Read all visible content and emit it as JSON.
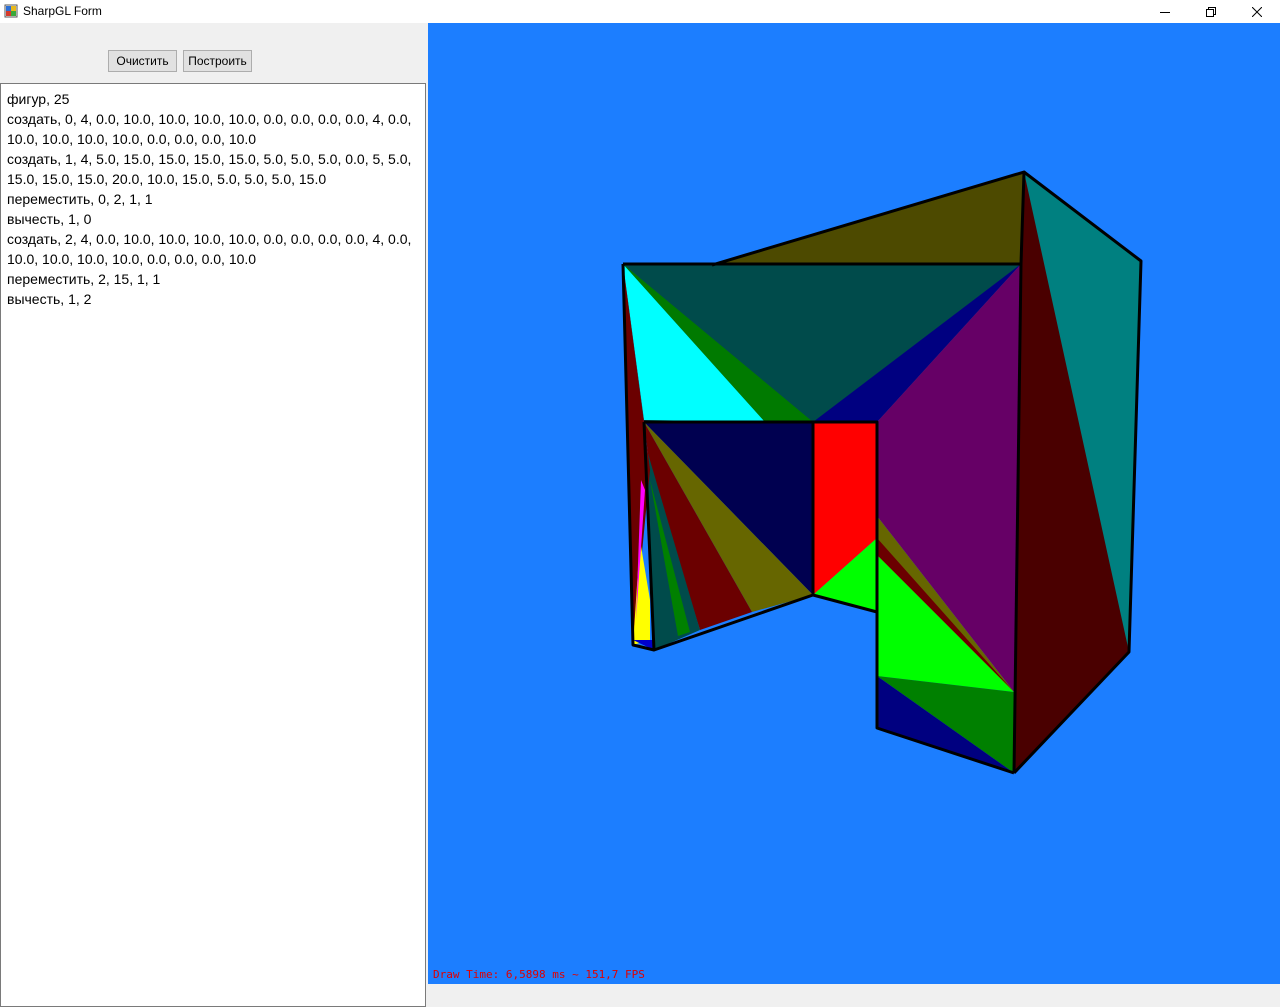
{
  "window": {
    "title": "SharpGL Form"
  },
  "toolbar": {
    "clear_label": "Очистить",
    "build_label": "Построить"
  },
  "script_text": "фигур, 25\nсоздать, 0, 4, 0.0, 10.0, 10.0, 10.0, 10.0, 0.0, 0.0, 0.0, 0.0, 4, 0.0, 10.0, 10.0, 10.0, 10.0, 0.0, 0.0, 0.0, 10.0\nсоздать, 1, 4, 5.0, 15.0, 15.0, 15.0, 15.0, 5.0, 5.0, 5.0, 0.0, 5, 5.0, 15.0, 15.0, 15.0, 20.0, 10.0, 15.0, 5.0, 5.0, 5.0, 15.0\nпереместить, 0, 2, 1, 1\nвычесть, 1, 0\nсоздать, 2, 4, 0.0, 10.0, 10.0, 10.0, 10.0, 0.0, 0.0, 0.0, 0.0, 4, 0.0, 10.0, 10.0, 10.0, 10.0, 0.0, 0.0, 0.0, 10.0\nпереместить, 2, 15, 1, 1\nвычесть, 1, 2",
  "canvas": {
    "background": "#1c7eff",
    "status_text": "Draw Time: 6,5898 ms ~ 151,7 FPS"
  },
  "icons": {
    "app": "app-icon",
    "minimize": "minimize-icon",
    "restore": "restore-icon",
    "close": "close-icon"
  }
}
